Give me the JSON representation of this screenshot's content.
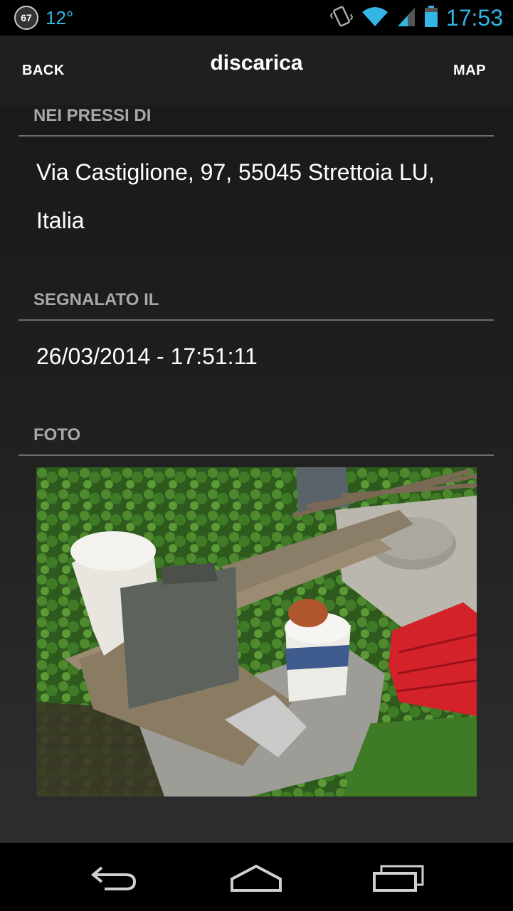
{
  "status_bar": {
    "notification_count": "67",
    "temperature": "12°",
    "time": "17:53",
    "accent_color": "#33b5e5"
  },
  "action_bar": {
    "back_label": "BACK",
    "title": "discarica",
    "map_label": "MAP"
  },
  "sections": {
    "nearby": {
      "header": "NEI PRESSI DI",
      "value_line1": "Via Castiglione, 97, 55045 Strettoia LU,",
      "value_line2": "Italia"
    },
    "reported": {
      "header": "SEGNALATO IL",
      "value": "26/03/2014 - 17:51:11"
    },
    "photo": {
      "header": "FOTO"
    }
  },
  "nav_bar": {
    "icons": [
      "back-icon",
      "home-icon",
      "recent-apps-icon"
    ]
  }
}
